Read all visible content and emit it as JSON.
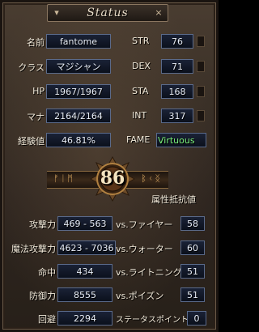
{
  "window": {
    "title": "Status"
  },
  "character": {
    "name_label": "名前",
    "name": "fantome",
    "class_label": "クラス",
    "class": "マジシャン",
    "hp_label": "HP",
    "hp": "1967/1967",
    "mana_label": "マナ",
    "mana": "2164/2164",
    "exp_label": "経験値",
    "exp": "46.81%",
    "level": "86"
  },
  "attributes": {
    "str_label": "STR",
    "str": "76",
    "dex_label": "DEX",
    "dex": "71",
    "sta_label": "STA",
    "sta": "168",
    "int_label": "INT",
    "int": "317",
    "fame_label": "FAME",
    "fame": "Virtuous"
  },
  "combat": {
    "attack_label": "攻撃力",
    "attack": "469 - 563",
    "magic_attack_label": "魔法攻撃力",
    "magic_attack": "4623 - 7036",
    "hit_label": "命中",
    "hit": "434",
    "defense_label": "防御力",
    "defense": "8555",
    "evasion_label": "回避",
    "evasion": "2294"
  },
  "resistances": {
    "header": "属性抵抗値",
    "fire_label": "vs.ファイヤー",
    "fire": "58",
    "water_label": "vs.ウォーター",
    "water": "60",
    "lightning_label": "vs.ライトニング",
    "lightning": "51",
    "poison_label": "vs.ポイズン",
    "poison": "51",
    "status_points_label": "ステータスポイント",
    "status_points": "0"
  },
  "emblem": {
    "runes_left": "ᚠᛁᛗ",
    "runes_right": "ᛒᚲᛝ"
  },
  "colors": {
    "fame": "#7af07a",
    "value_border": "#5a6a8a",
    "panel": "#3a3027"
  }
}
